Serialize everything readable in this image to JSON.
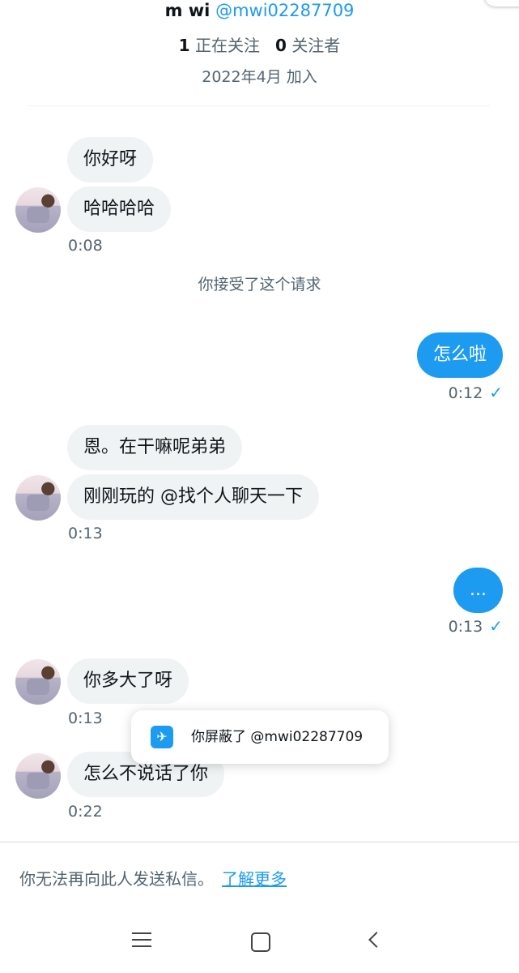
{
  "profile": {
    "name": "m wi",
    "handle": "@mwi02287709",
    "following_count": "1",
    "following_label": "正在关注",
    "followers_count": "0",
    "followers_label": "关注者",
    "joined": "2022年4月 加入"
  },
  "messages": {
    "m1": "你好呀",
    "m2": "哈哈哈哈",
    "t1": "0:08",
    "system": "你接受了这个请求",
    "m3": "怎么啦",
    "t2": "0:12",
    "m4": "恩。在干嘛呢弟弟",
    "m5": "刚刚玩的 @找个人聊天一下",
    "t3": "0:13",
    "m6": "...",
    "t4": "0:13",
    "m7": "你多大了呀",
    "t5": "0:13",
    "m8": "怎么不说话了你",
    "t6": "0:22",
    "check": "✓"
  },
  "toast": {
    "text": "你屏蔽了 @mwi02287709",
    "icon": "twitter-bird-icon"
  },
  "footer": {
    "notice": "你无法再向此人发送私信。",
    "link": "了解更多"
  },
  "navbar": {
    "icons": [
      "menu-icon",
      "home-icon",
      "back-icon"
    ]
  },
  "colors": {
    "accent": "#1d9bf0",
    "incoming_bubble": "#eff3f4",
    "secondary_text": "#536471"
  }
}
